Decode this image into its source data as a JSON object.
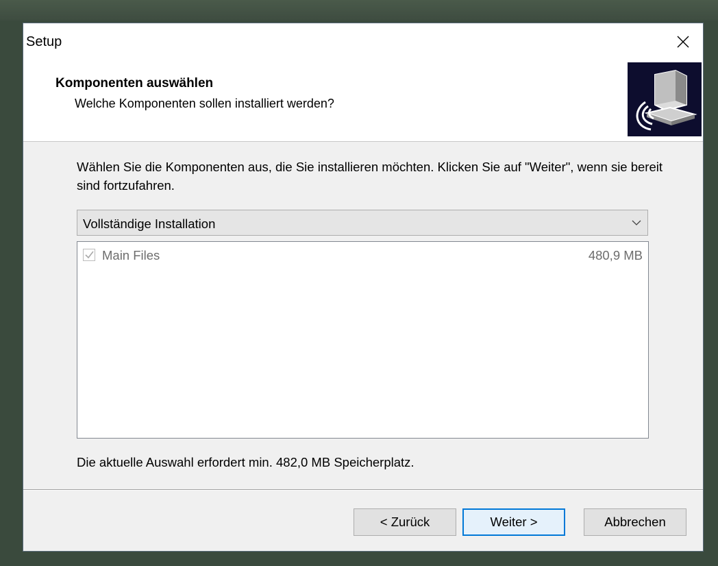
{
  "window": {
    "title": "Setup",
    "close_icon": "close-icon"
  },
  "header": {
    "title": "Komponenten auswählen",
    "subtitle": "Welche Komponenten sollen installiert werden?",
    "icon": "setup-computer-icon"
  },
  "body": {
    "instructions": "Wählen Sie die Komponenten aus, die Sie installieren möchten. Klicken Sie auf \"Weiter\", wenn sie bereit sind fortzufahren.",
    "install_type": {
      "selected": "Vollständige Installation"
    },
    "components": [
      {
        "name": "Main Files",
        "size": "480,9 MB",
        "checked": true,
        "disabled": true
      }
    ],
    "status": "Die aktuelle Auswahl erfordert min. 482,0 MB Speicherplatz."
  },
  "buttons": {
    "back": "< Zurück",
    "next": "Weiter >",
    "cancel": "Abbrechen"
  },
  "colors": {
    "accent": "#0078d7",
    "icon_bg": "#0d0d2e"
  }
}
